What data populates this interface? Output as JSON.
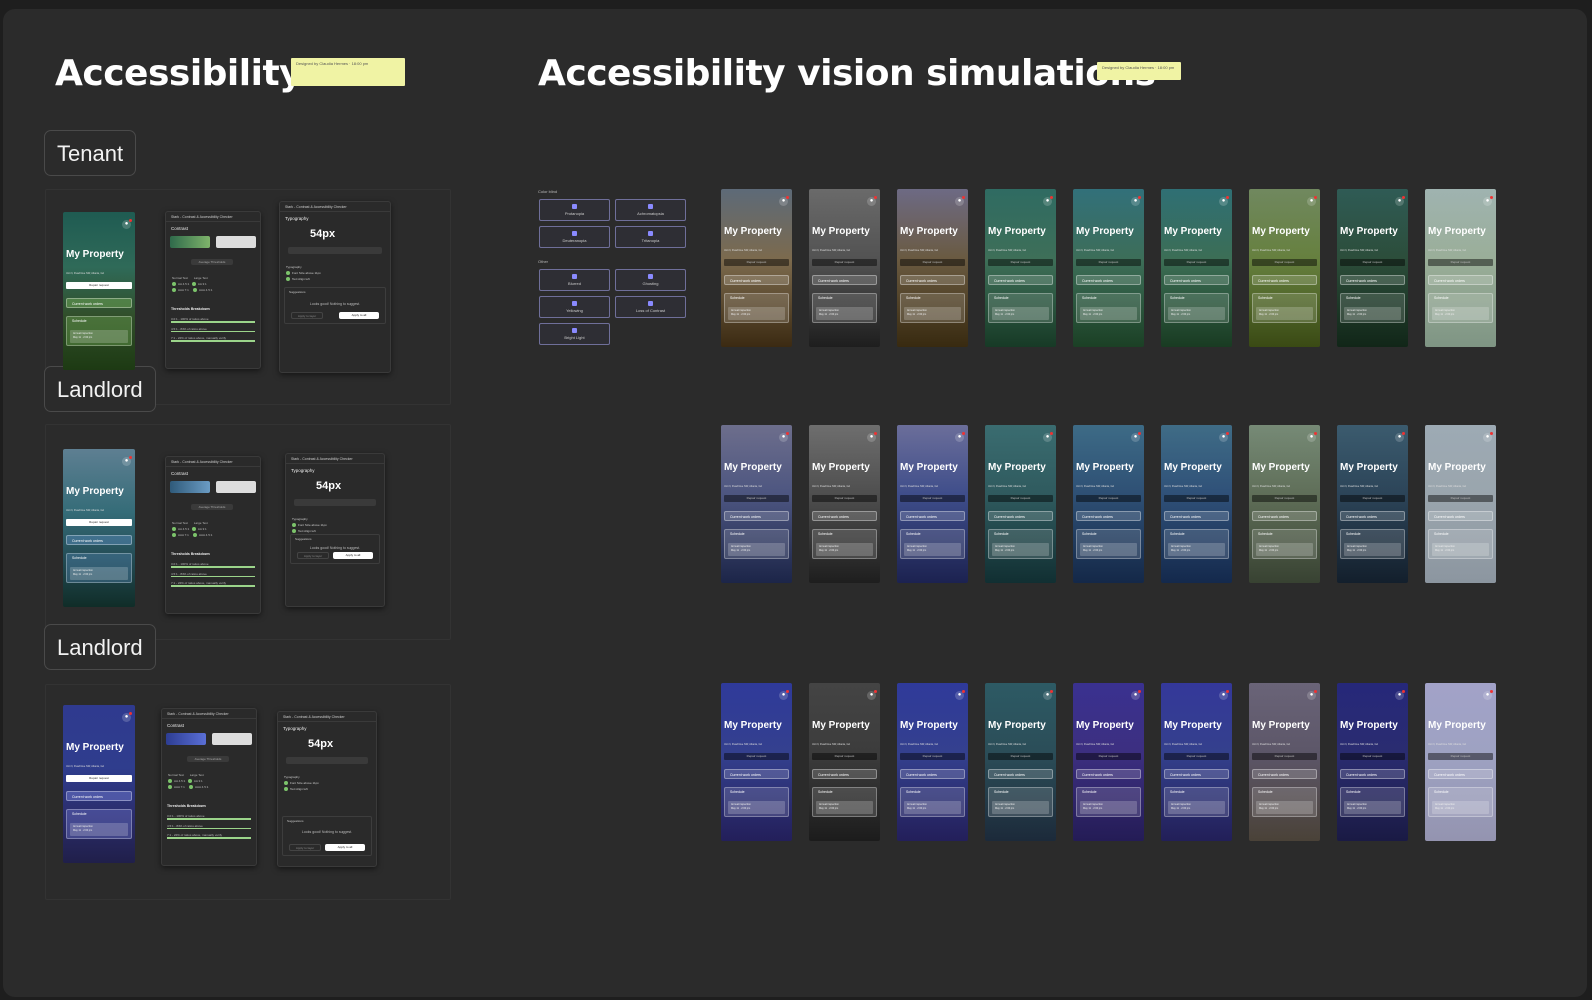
{
  "headings": {
    "left": "Accessibility",
    "right": "Accessibility vision simulations"
  },
  "sticky": {
    "left": "Designed by Claudia Hermes · 18:00 pm",
    "right": "Designed by Claudia Hermes · 18:00 pm"
  },
  "sections": [
    "Tenant",
    "Landlord",
    "Landlord"
  ],
  "phone": {
    "title": "My Property",
    "address": "Unit 3, Peachtree NW, Atlanta, GA",
    "request": "Repair request",
    "work_orders": "Current work orders",
    "schedule": "Schedule",
    "inspection": "Annual inspection",
    "inspection_date": "May 11 · 2:00 pm"
  },
  "panel": {
    "title": "Stark - Contrast & Accessibility Checker",
    "contrast": "Contrast",
    "toggle": "Average  Thresholds",
    "normal_text": "Normal Text",
    "large_text": "Large Text",
    "aa_normal": "AA 4.5:1",
    "aaa_normal": "AAA 7:1",
    "aa_large": "AA 3:1",
    "aaa_large": "AAA 4.5:1",
    "thresholds": "Thresholds Breakdown",
    "t1": "3.0:1 - 100% of ratios above",
    "t2": "4.5:1 - 84% of ratios above",
    "t3": "7:1 - 22% of ratios above, manually verify",
    "typography": "Typography",
    "px": "54px",
    "typo_label": "Typography",
    "check1": "Font Size above 11px",
    "check2": "Text Align left",
    "suggestions": "Suggestions",
    "looks_good": "Looks good! Nothing to suggest.",
    "apply_layer": "Apply to layer",
    "apply_all": "Apply to all"
  },
  "colorblind": {
    "label": "Color blind",
    "items": [
      "Protanopia",
      "Achromatopsia",
      "Deuteranopia",
      "Tritanopia"
    ],
    "other_label": "Other",
    "other": [
      "Blurred",
      "Ghosting",
      "Yellowing",
      "Loss of Contrast",
      "Bright Light"
    ]
  },
  "colors": {
    "canvas": "#2b2b2b",
    "sticky": "#f0f3a4",
    "accent": "#7cc46b"
  }
}
